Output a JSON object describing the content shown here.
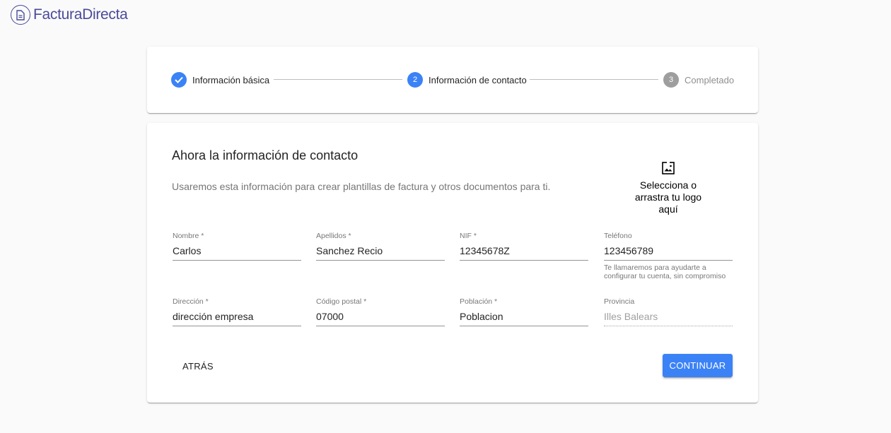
{
  "app": {
    "brand": "FacturaDirecta"
  },
  "stepper": {
    "steps": [
      {
        "number": "1",
        "label": "Información básica",
        "state": "completed"
      },
      {
        "number": "2",
        "label": "Información de contacto",
        "state": "active"
      },
      {
        "number": "3",
        "label": "Completado",
        "state": "pending"
      }
    ]
  },
  "form": {
    "title": "Ahora la información de contacto",
    "subtitle": "Usaremos esta información para crear plantillas de factura y otros documentos para ti.",
    "logo_upload": {
      "icon": "image-upload-icon",
      "label": "Selecciona o arrastra tu logo aquí"
    },
    "fields": {
      "nombre": {
        "label": "Nombre *",
        "value": "Carlos"
      },
      "apellidos": {
        "label": "Apellidos *",
        "value": "Sanchez Recio"
      },
      "nif": {
        "label": "NIF *",
        "value": "12345678Z"
      },
      "telefono": {
        "label": "Teléfono",
        "value": "123456789",
        "helper": "Te llamaremos para ayudarte a configurar tu cuenta, sin compromiso"
      },
      "direccion": {
        "label": "Dirección *",
        "value": "dirección empresa"
      },
      "codigo_postal": {
        "label": "Código postal *",
        "value": "07000"
      },
      "poblacion": {
        "label": "Población *",
        "value": "Poblacion"
      },
      "provincia": {
        "label": "Provincia",
        "value": "Illes Balears",
        "disabled": true
      }
    },
    "back_label": "ATRÁS",
    "continue_label": "CONTINUAR"
  },
  "colors": {
    "accent": "#3b82f6",
    "brand": "#4a4a9a",
    "inactive_step": "#9e9e9e"
  }
}
